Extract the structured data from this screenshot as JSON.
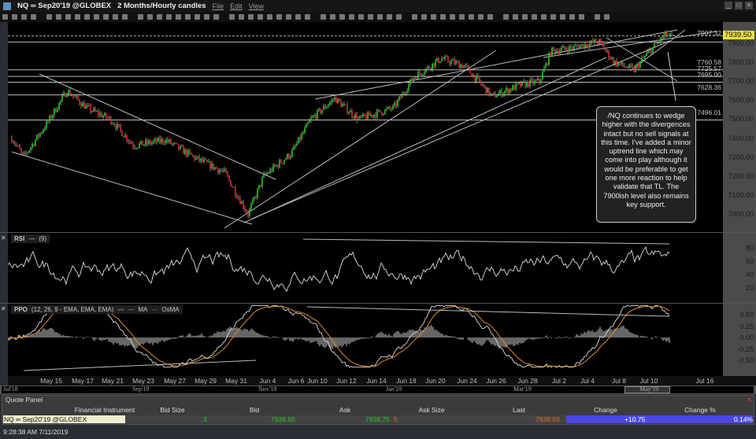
{
  "window": {
    "instrument": "NQ ∞ Sep20'19 @GLOBEX",
    "timeframe": "2 Months/Hourly candles",
    "menus": [
      "File",
      "Edit",
      "View"
    ]
  },
  "price_axis": {
    "ticks": [
      "7900.00",
      "7800.00",
      "7700.00",
      "7600.00",
      "7500.00",
      "7400.00",
      "7300.00",
      "7200.00",
      "7100.00",
      "7000.00"
    ],
    "last": "7939.50"
  },
  "levels": [
    "7907.32",
    "7760.58",
    "7725.57",
    "7695.00",
    "7628.36",
    "7496.01"
  ],
  "annotation": "/NQ continues to wedge higher with the divergences intact but no sell signals at this time. I've added a minor uptrend line which may come into play although it would be preferable to get one more reaction to help validate that TL. The 7900ish level also remains key support.",
  "rsi": {
    "label": "RSI",
    "params": "(9)",
    "ticks": [
      "80",
      "60",
      "40",
      "20"
    ]
  },
  "ppo": {
    "label": "PPO",
    "params": "(12, 26, 9 - EMA, EMA, EMA)",
    "ma": "MA",
    "osma": "OsMA",
    "ticks": [
      "0.50",
      "0.25",
      "0.00",
      "-0.25",
      "-0.50"
    ]
  },
  "xaxis": [
    "May 15",
    "May 17",
    "May 21",
    "May 23",
    "May 27",
    "May 29",
    "May 31",
    "Jun 4",
    "Jun 6",
    "Jun 10",
    "Jun 12",
    "Jun 14",
    "Jun 18",
    "Jun 20",
    "Jun 24",
    "Jun 26",
    "Jun 28",
    "Jul 2",
    "Jul 4",
    "Jul 8",
    "Jul 10",
    "Jul 16"
  ],
  "scroll_labels": [
    "Jul'18",
    "Sep'18",
    "Nov'18",
    "Jan'19",
    "Mar'19",
    "May'19"
  ],
  "quote_panel": {
    "title": "Quote Panel",
    "headers": [
      "Financial Instrument",
      "Bid Size",
      "Bid",
      "Ask",
      "Ask Size",
      "Last",
      "Change",
      "Change %"
    ],
    "row": {
      "instrument": "NQ ∞ Sep20'19 @GLOBEX",
      "bid_size": "3",
      "bid": "7939.50",
      "ask": "7939.75",
      "ask_size": "5",
      "last": "7939.50",
      "change": "+10.75",
      "change_pct": "0.14%"
    }
  },
  "status": "9:28:38 AM 7/11/2019"
}
